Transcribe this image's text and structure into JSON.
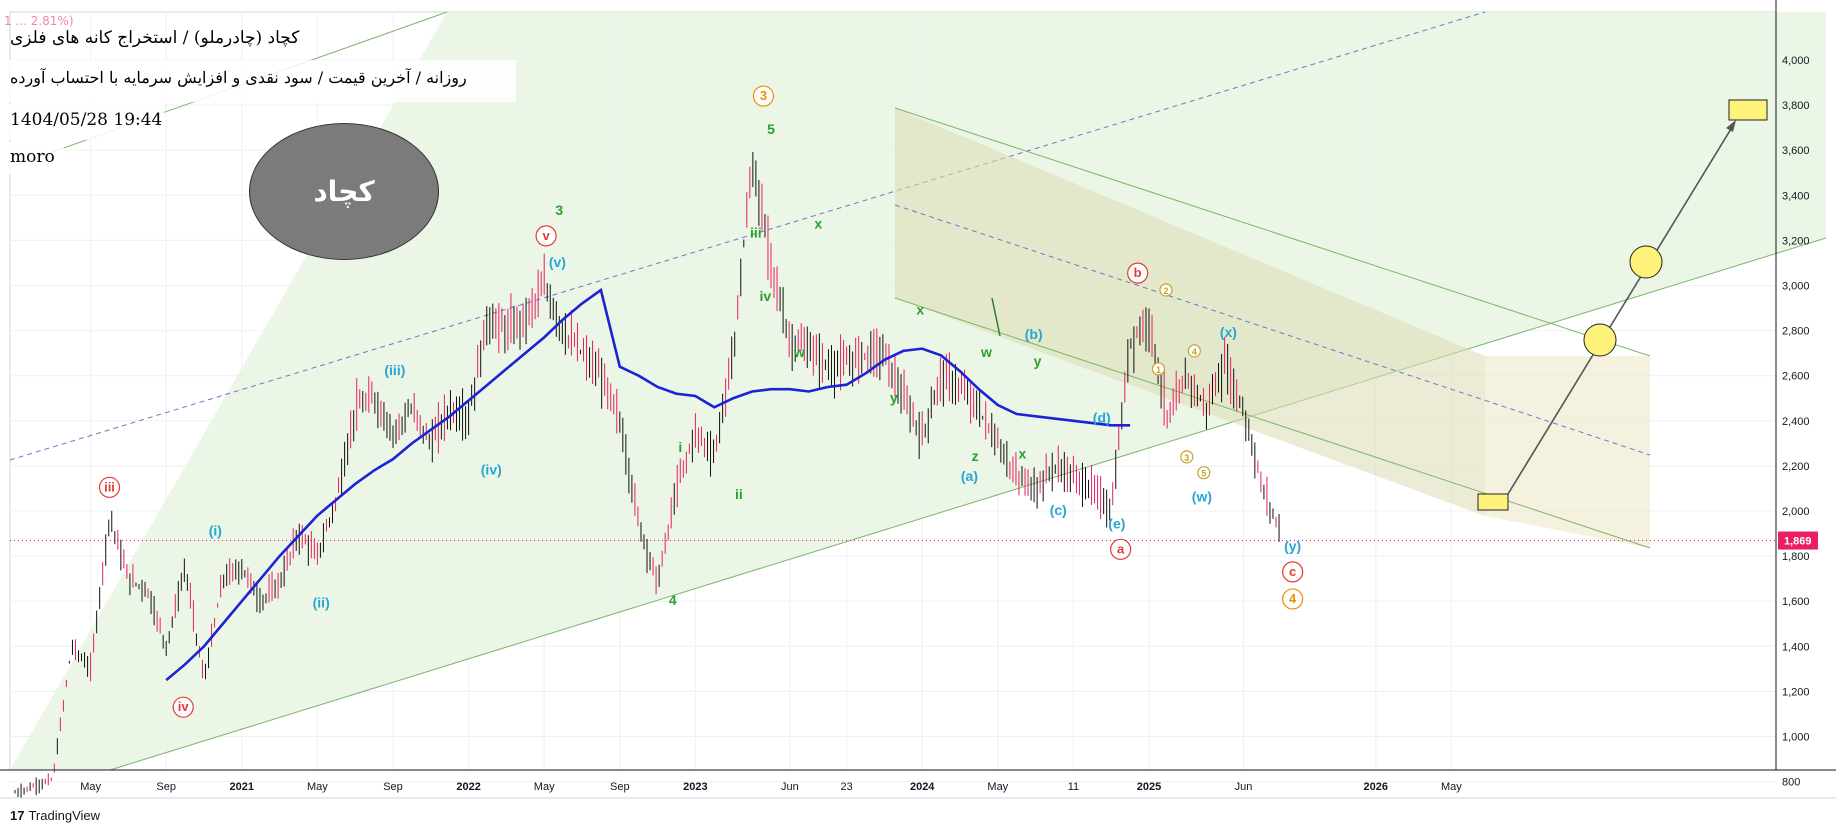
{
  "header": {
    "ohlc_line": "1 ... 2.81%)",
    "title": "کچاد (چادرملو) / استخراج کانه های فلزی",
    "subtitle": "روزانه / آخرین قیمت / سود نقدی و افزایش سرمایه با احتساب آورده",
    "date": "1404/05/28 19:44",
    "author": "moro",
    "ticker_badge": "کچاد"
  },
  "branding": {
    "logo": "17",
    "name": "TradingView"
  },
  "colors": {
    "bg_channel": "#e8f4e2",
    "down_channel": "#dcdcb4",
    "future_channel": "#ece8c8",
    "ma": "#1c22d6",
    "candle_up": "#111111",
    "candle_down": "#e91e63",
    "last_price": "#e91e63",
    "wave_red": "#e53935",
    "wave_cyan": "#26a6d1",
    "wave_green": "#2e9e2e",
    "wave_orange": "#f08c00",
    "wave_gold": "#c9a227"
  },
  "chart_data": {
    "type": "candlestick",
    "ylim": [
      700,
      4000
    ],
    "y_ticks": [
      800,
      1000,
      1200,
      1400,
      1600,
      1800,
      2000,
      2200,
      2400,
      2600,
      2800,
      3000,
      3200,
      3400,
      3600,
      3800,
      4000
    ],
    "y_tick_labels": [
      "800",
      "1,000",
      "1,200",
      "1,400",
      "1,600",
      "1,800",
      "2,000",
      "2,200",
      "2,400",
      "2,600",
      "2,800",
      "3,000",
      "3,200",
      "3,400",
      "3,600",
      "3,800",
      "4,000"
    ],
    "x_ticks": [
      {
        "label": "May",
        "t": 4,
        "bold": false
      },
      {
        "label": "Sep",
        "t": 8,
        "bold": false
      },
      {
        "label": "2021",
        "t": 12,
        "bold": true
      },
      {
        "label": "May",
        "t": 16,
        "bold": false
      },
      {
        "label": "Sep",
        "t": 20,
        "bold": false
      },
      {
        "label": "2022",
        "t": 24,
        "bold": true
      },
      {
        "label": "May",
        "t": 28,
        "bold": false
      },
      {
        "label": "Sep",
        "t": 32,
        "bold": false
      },
      {
        "label": "2023",
        "t": 36,
        "bold": true
      },
      {
        "label": "Jun",
        "t": 41,
        "bold": false
      },
      {
        "label": "23",
        "t": 44,
        "bold": false
      },
      {
        "label": "2024",
        "t": 48,
        "bold": true
      },
      {
        "label": "May",
        "t": 52,
        "bold": false
      },
      {
        "label": "11",
        "t": 56,
        "bold": false
      },
      {
        "label": "2025",
        "t": 60,
        "bold": true
      },
      {
        "label": "Jun",
        "t": 65,
        "bold": false
      },
      {
        "label": "2026",
        "t": 72,
        "bold": true
      },
      {
        "label": "May",
        "t": 76,
        "bold": false
      }
    ],
    "last_price": 1869,
    "last_price_label": "1,869",
    "price_path": [
      [
        0,
        750
      ],
      [
        1,
        780
      ],
      [
        2,
        810
      ],
      [
        3,
        1400
      ],
      [
        4,
        1300
      ],
      [
        5,
        1980
      ],
      [
        6,
        1700
      ],
      [
        7,
        1650
      ],
      [
        8,
        1400
      ],
      [
        9,
        1750
      ],
      [
        10,
        1250
      ],
      [
        11,
        1700
      ],
      [
        12,
        1750
      ],
      [
        13,
        1600
      ],
      [
        14,
        1680
      ],
      [
        15,
        1900
      ],
      [
        16,
        1800
      ],
      [
        17,
        2050
      ],
      [
        18,
        2450
      ],
      [
        19,
        2500
      ],
      [
        20,
        2350
      ],
      [
        21,
        2450
      ],
      [
        22,
        2300
      ],
      [
        23,
        2450
      ],
      [
        24,
        2420
      ],
      [
        25,
        2850
      ],
      [
        26,
        2800
      ],
      [
        27,
        2850
      ],
      [
        28,
        3000
      ],
      [
        29,
        2800
      ],
      [
        30,
        2700
      ],
      [
        31,
        2600
      ],
      [
        32,
        2400
      ],
      [
        33,
        1950
      ],
      [
        34,
        1680
      ],
      [
        35,
        2100
      ],
      [
        36,
        2350
      ],
      [
        37,
        2250
      ],
      [
        38,
        2700
      ],
      [
        39,
        3550
      ],
      [
        40,
        3100
      ],
      [
        41,
        2750
      ],
      [
        42,
        2720
      ],
      [
        43,
        2640
      ],
      [
        44,
        2650
      ],
      [
        45,
        2700
      ],
      [
        46,
        2700
      ],
      [
        47,
        2500
      ],
      [
        48,
        2330
      ],
      [
        49,
        2600
      ],
      [
        50,
        2550
      ],
      [
        51,
        2450
      ],
      [
        52,
        2300
      ],
      [
        53,
        2150
      ],
      [
        54,
        2100
      ],
      [
        55,
        2200
      ],
      [
        56,
        2150
      ],
      [
        57,
        2100
      ],
      [
        58,
        2000
      ],
      [
        59,
        2750
      ],
      [
        60,
        2850
      ],
      [
        61,
        2400
      ],
      [
        62,
        2600
      ],
      [
        63,
        2450
      ],
      [
        64,
        2650
      ],
      [
        65,
        2450
      ],
      [
        66,
        2100
      ],
      [
        67,
        1900
      ]
    ],
    "moving_average": [
      [
        8,
        1250
      ],
      [
        9,
        1320
      ],
      [
        10,
        1400
      ],
      [
        11,
        1500
      ],
      [
        12,
        1600
      ],
      [
        13,
        1700
      ],
      [
        14,
        1800
      ],
      [
        15,
        1890
      ],
      [
        16,
        1980
      ],
      [
        17,
        2050
      ],
      [
        18,
        2120
      ],
      [
        19,
        2180
      ],
      [
        20,
        2230
      ],
      [
        21,
        2300
      ],
      [
        22,
        2360
      ],
      [
        23,
        2420
      ],
      [
        24,
        2490
      ],
      [
        25,
        2560
      ],
      [
        26,
        2630
      ],
      [
        27,
        2700
      ],
      [
        28,
        2770
      ],
      [
        29,
        2850
      ],
      [
        30,
        2920
      ],
      [
        31,
        2980
      ],
      [
        32,
        2640
      ],
      [
        33,
        2600
      ],
      [
        34,
        2550
      ],
      [
        35,
        2520
      ],
      [
        36,
        2510
      ],
      [
        37,
        2460
      ],
      [
        38,
        2500
      ],
      [
        39,
        2530
      ],
      [
        40,
        2540
      ],
      [
        41,
        2540
      ],
      [
        42,
        2530
      ],
      [
        43,
        2550
      ],
      [
        44,
        2560
      ],
      [
        45,
        2610
      ],
      [
        46,
        2670
      ],
      [
        47,
        2710
      ],
      [
        48,
        2720
      ],
      [
        49,
        2690
      ],
      [
        50,
        2620
      ],
      [
        51,
        2540
      ],
      [
        52,
        2470
      ],
      [
        53,
        2430
      ],
      [
        54,
        2420
      ],
      [
        55,
        2410
      ],
      [
        56,
        2400
      ],
      [
        57,
        2390
      ],
      [
        58,
        2380
      ],
      [
        59,
        2380
      ]
    ],
    "wave_labels": [
      {
        "text": "iii",
        "circle": true,
        "color": "red",
        "t": 5,
        "p": 2105
      },
      {
        "text": "iv",
        "circle": true,
        "color": "red",
        "t": 8.9,
        "p": 1130
      },
      {
        "text": "v",
        "circle": true,
        "color": "red",
        "t": 28.1,
        "p": 3220
      },
      {
        "text": "a",
        "circle": true,
        "color": "red",
        "t": 58.5,
        "p": 1830
      },
      {
        "text": "b",
        "circle": true,
        "color": "red",
        "t": 59.4,
        "p": 3055
      },
      {
        "text": "c",
        "circle": true,
        "color": "red",
        "t": 67.6,
        "p": 1730
      },
      {
        "text": "3",
        "circle": true,
        "color": "orange",
        "t": 39.6,
        "p": 3840
      },
      {
        "text": "4",
        "circle": true,
        "color": "orange",
        "t": 67.6,
        "p": 1610
      },
      {
        "text": "(i)",
        "circle": false,
        "color": "cyan",
        "t": 10.6,
        "p": 1910
      },
      {
        "text": "(ii)",
        "circle": false,
        "color": "cyan",
        "t": 16.2,
        "p": 1590
      },
      {
        "text": "(iii)",
        "circle": false,
        "color": "cyan",
        "t": 20.1,
        "p": 2620
      },
      {
        "text": "(iv)",
        "circle": false,
        "color": "cyan",
        "t": 25.2,
        "p": 2180
      },
      {
        "text": "(v)",
        "circle": false,
        "color": "cyan",
        "t": 28.7,
        "p": 3100
      },
      {
        "text": "(a)",
        "circle": false,
        "color": "cyan",
        "t": 50.5,
        "p": 2150
      },
      {
        "text": "(b)",
        "circle": false,
        "color": "cyan",
        "t": 53.9,
        "p": 2780
      },
      {
        "text": "(c)",
        "circle": false,
        "color": "cyan",
        "t": 55.2,
        "p": 2000
      },
      {
        "text": "(d)",
        "circle": false,
        "color": "cyan",
        "t": 57.5,
        "p": 2410
      },
      {
        "text": "(e)",
        "circle": false,
        "color": "cyan",
        "t": 58.3,
        "p": 1940
      },
      {
        "text": "(w)",
        "circle": false,
        "color": "cyan",
        "t": 62.8,
        "p": 2060
      },
      {
        "text": "(x)",
        "circle": false,
        "color": "cyan",
        "t": 64.2,
        "p": 2790
      },
      {
        "text": "(y)",
        "circle": false,
        "color": "cyan",
        "t": 67.6,
        "p": 1840
      },
      {
        "text": "3",
        "circle": false,
        "color": "green",
        "t": 28.8,
        "p": 3330
      },
      {
        "text": "5",
        "circle": false,
        "color": "green",
        "t": 40.0,
        "p": 3690
      },
      {
        "text": "4",
        "circle": false,
        "color": "green",
        "t": 34.8,
        "p": 1600
      },
      {
        "text": "iii",
        "circle": false,
        "color": "green",
        "t": 39.2,
        "p": 3230
      },
      {
        "text": "iv",
        "circle": false,
        "color": "green",
        "t": 39.7,
        "p": 2950
      },
      {
        "text": "i",
        "circle": false,
        "color": "green",
        "t": 35.2,
        "p": 2280
      },
      {
        "text": "ii",
        "circle": false,
        "color": "green",
        "t": 38.3,
        "p": 2070
      },
      {
        "text": "w",
        "circle": false,
        "color": "green",
        "t": 41.5,
        "p": 2700
      },
      {
        "text": "x",
        "circle": false,
        "color": "green",
        "t": 42.5,
        "p": 3270
      },
      {
        "text": "y",
        "circle": false,
        "color": "green",
        "t": 46.5,
        "p": 2500
      },
      {
        "text": "x",
        "circle": false,
        "color": "green",
        "t": 47.9,
        "p": 2890
      },
      {
        "text": "w",
        "circle": false,
        "color": "green",
        "t": 51.4,
        "p": 2700
      },
      {
        "text": "z",
        "circle": false,
        "color": "green",
        "t": 50.8,
        "p": 2240
      },
      {
        "text": "x",
        "circle": false,
        "color": "green",
        "t": 53.3,
        "p": 2250
      },
      {
        "text": "y",
        "circle": false,
        "color": "green",
        "t": 54.1,
        "p": 2660
      },
      {
        "text": "1",
        "circle": true,
        "color": "gold",
        "t": 60.5,
        "p": 2630
      },
      {
        "text": "2",
        "circle": true,
        "color": "gold",
        "t": 60.9,
        "p": 2980
      },
      {
        "text": "3",
        "circle": true,
        "color": "gold",
        "t": 62.0,
        "p": 2240
      },
      {
        "text": "4",
        "circle": true,
        "color": "gold",
        "t": 62.4,
        "p": 2710
      },
      {
        "text": "5",
        "circle": true,
        "color": "gold",
        "t": 62.9,
        "p": 2170
      }
    ]
  }
}
